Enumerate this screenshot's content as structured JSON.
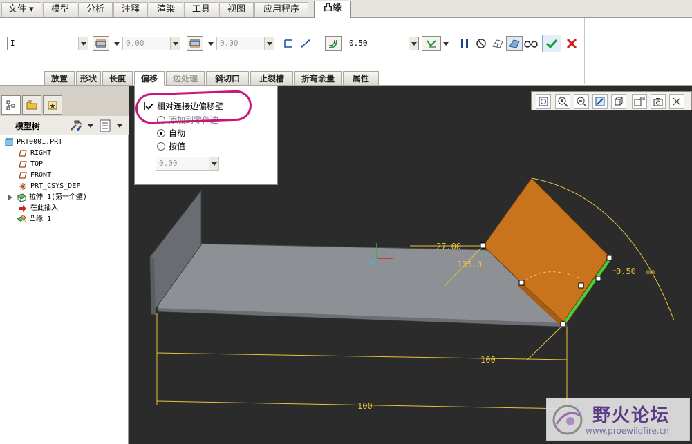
{
  "menu": {
    "tabs": [
      {
        "label": "文件",
        "arrow": "▾"
      },
      {
        "label": "模型"
      },
      {
        "label": "分析"
      },
      {
        "label": "注释"
      },
      {
        "label": "渲染"
      },
      {
        "label": "工具"
      },
      {
        "label": "视图"
      },
      {
        "label": "应用程序"
      },
      {
        "label": "凸缘",
        "active": true
      }
    ]
  },
  "ribbon": {
    "shape_select": "I",
    "length1_value": "0.00",
    "length2_value": "0.00",
    "thickness_value": "0.50",
    "subtabs": [
      {
        "label": "放置"
      },
      {
        "label": "形状"
      },
      {
        "label": "长度"
      },
      {
        "label": "偏移",
        "active": true
      },
      {
        "label": "边处理",
        "dim": true
      },
      {
        "label": "斜切口"
      },
      {
        "label": "止裂槽"
      },
      {
        "label": "折弯余量"
      },
      {
        "label": "属性"
      }
    ]
  },
  "offset_panel": {
    "relative_offset_label": "相对连接边偏移壁",
    "relative_offset_checked": true,
    "add_to_part_label": "添加到零件边",
    "auto_label": "自动",
    "by_value_label": "按值",
    "value": "0.00"
  },
  "model_tree": {
    "header": "模型树",
    "items": [
      {
        "label": "PRT0001.PRT",
        "icon": "part-icon"
      },
      {
        "label": "RIGHT",
        "icon": "datum-plane-icon"
      },
      {
        "label": "TOP",
        "icon": "datum-plane-icon"
      },
      {
        "label": "FRONT",
        "icon": "datum-plane-icon"
      },
      {
        "label": "PRT_CSYS_DEF",
        "icon": "csys-icon"
      },
      {
        "label": "拉伸 1(第一个壁)",
        "icon": "extrude-wall-icon"
      },
      {
        "label": "在此插入",
        "icon": "insert-here-icon"
      },
      {
        "label": "凸缘 1",
        "icon": "flange-icon"
      }
    ]
  },
  "viewport": {
    "dim_27": "27.00",
    "dim_135": "135.0",
    "dim_thick": "0.50",
    "dim_thick_unit": "mm",
    "dim_100a": "100",
    "dim_100b": "100"
  },
  "watermark": {
    "title": "野火论坛",
    "url": "www.proewildfire.cn"
  },
  "colors": {
    "flange": "#c8741c",
    "base_plate": "#8d9195",
    "dimension": "#e8c33a",
    "highlight": "#c8157a",
    "accept": "#1a9e2a",
    "cancel": "#d11a1a"
  }
}
